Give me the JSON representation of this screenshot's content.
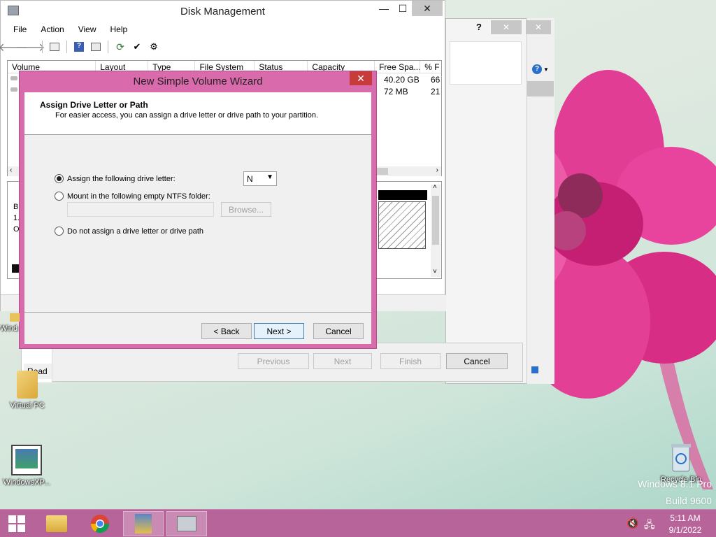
{
  "desktop": {
    "icons": [
      {
        "label": "Wind"
      },
      {
        "label": "Virtual PC"
      },
      {
        "label": "WindowsXP..."
      },
      {
        "label": "Recycle Bin"
      }
    ],
    "watermark_line1": "Windows 8.1 Pro",
    "watermark_line2": "Build 9600"
  },
  "disk_management": {
    "title": "Disk Management",
    "menu": [
      "File",
      "Action",
      "View",
      "Help"
    ],
    "columns": [
      "Volume",
      "Layout",
      "Type",
      "File System",
      "Status",
      "Capacity",
      "Free Spa...",
      "% F"
    ],
    "rows": [
      {
        "free": "40.20 GB",
        "pct": "66"
      },
      {
        "free": "72 MB",
        "pct": "21"
      }
    ],
    "lower_labels": [
      "B",
      "1.",
      "O"
    ],
    "status_text": "Read"
  },
  "outer_wizard": {
    "previous": "Previous",
    "next": "Next",
    "finish": "Finish",
    "cancel": "Cancel"
  },
  "wizard": {
    "title": "New Simple Volume Wizard",
    "heading": "Assign Drive Letter or Path",
    "subtitle": "For easier access, you can assign a drive letter or drive path to your partition.",
    "option_assign": "Assign the following drive letter:",
    "drive_letter": "N",
    "option_mount": "Mount in the following empty NTFS folder:",
    "browse": "Browse...",
    "option_none": "Do not assign a drive letter or drive path",
    "back": "< Back",
    "next": "Next >",
    "cancel": "Cancel"
  },
  "taskbar": {
    "time": "5:11 AM",
    "date": "9/1/2022"
  }
}
